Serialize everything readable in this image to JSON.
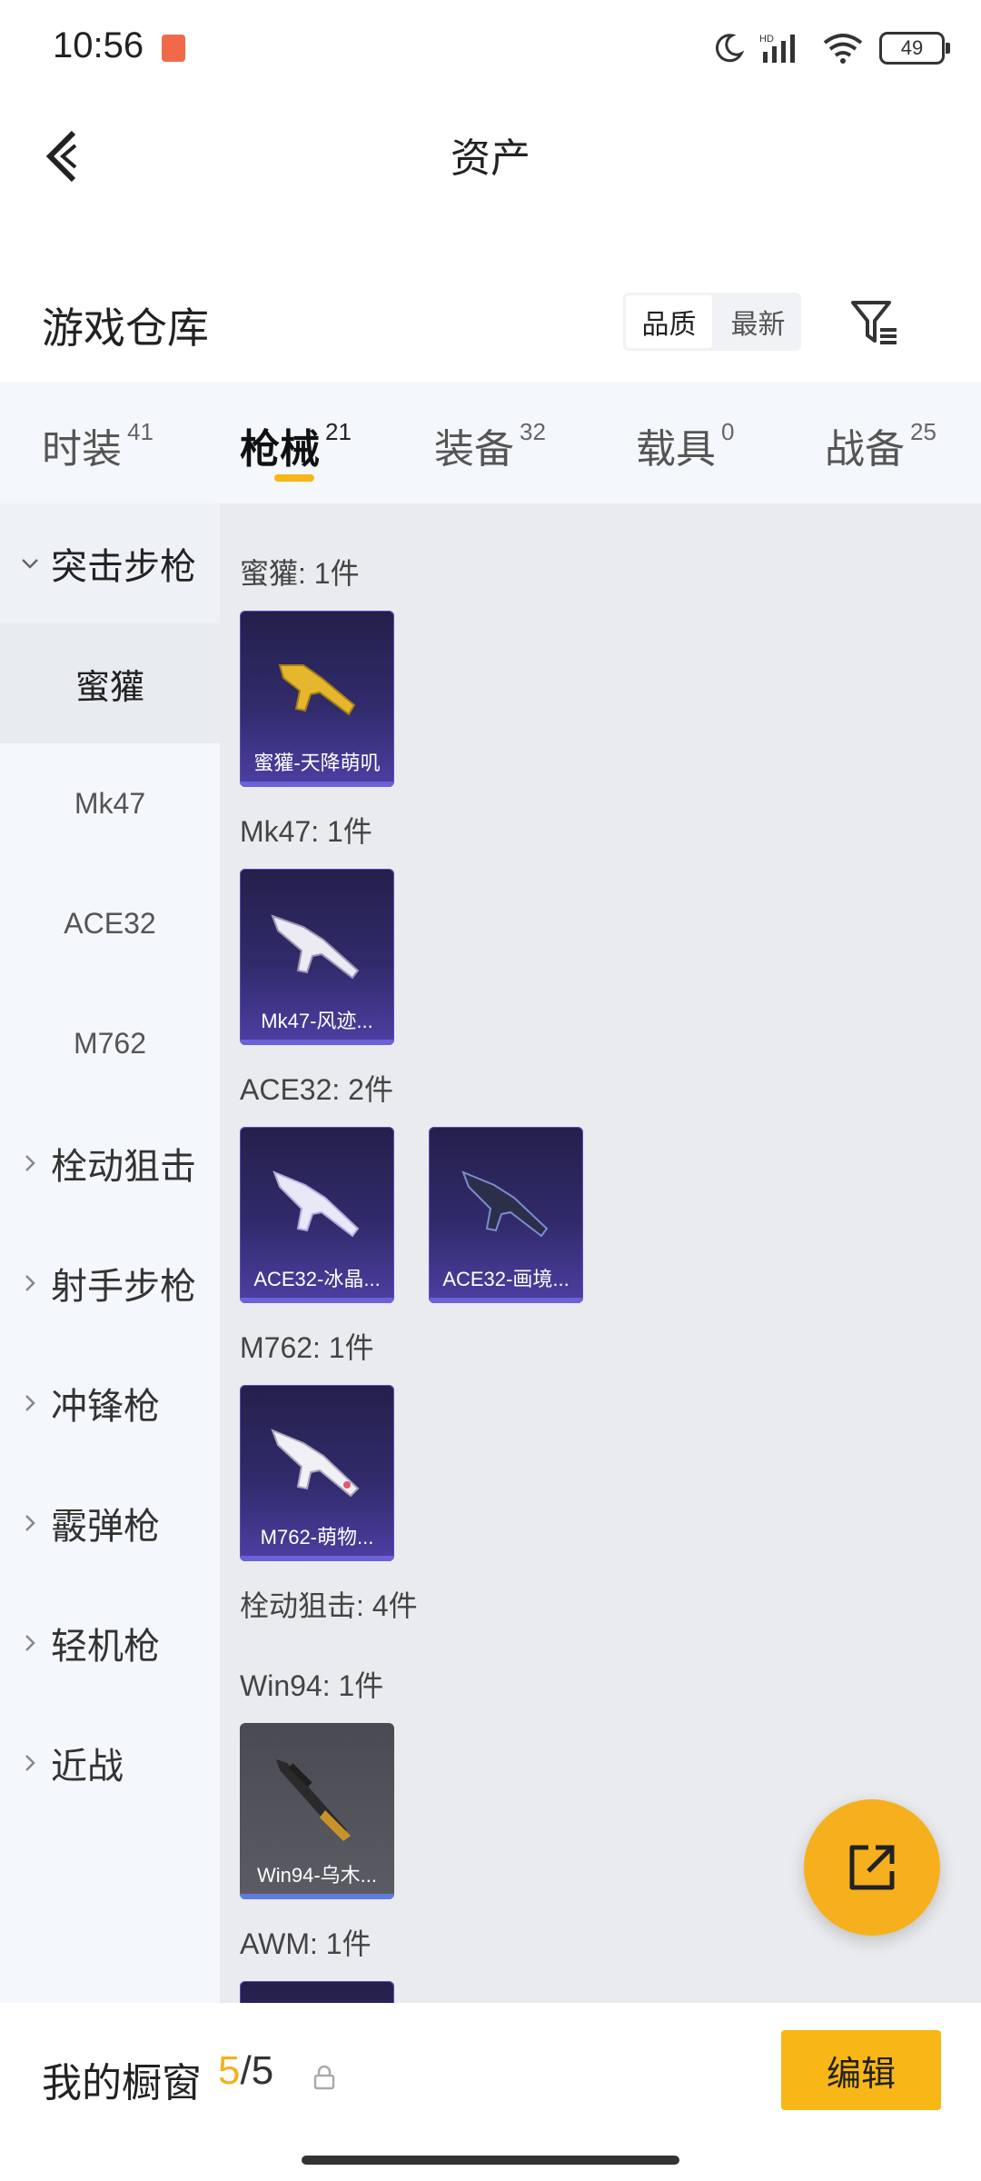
{
  "status_bar": {
    "time": "10:56",
    "battery": "49"
  },
  "header": {
    "title": "资产"
  },
  "warehouse": {
    "title": "游戏仓库",
    "sort_options": [
      "品质",
      "最新"
    ],
    "sort_active": "品质"
  },
  "tabs": [
    {
      "label": "时装",
      "count": "41"
    },
    {
      "label": "枪械",
      "count": "21",
      "active": true
    },
    {
      "label": "装备",
      "count": "32"
    },
    {
      "label": "载具",
      "count": "0"
    },
    {
      "label": "战备",
      "count": "25"
    }
  ],
  "sidebar": [
    {
      "label": "突击步枪",
      "type": "group",
      "open": true
    },
    {
      "label": "蜜獾",
      "type": "sub",
      "active": true
    },
    {
      "label": "Mk47",
      "type": "sub"
    },
    {
      "label": "ACE32",
      "type": "sub"
    },
    {
      "label": "M762",
      "type": "sub"
    },
    {
      "label": "栓动狙击",
      "type": "group"
    },
    {
      "label": "射手步枪",
      "type": "group"
    },
    {
      "label": "冲锋枪",
      "type": "group"
    },
    {
      "label": "霰弹枪",
      "type": "group"
    },
    {
      "label": "轻机枪",
      "type": "group"
    },
    {
      "label": "近战",
      "type": "group"
    }
  ],
  "content": {
    "sections": [
      {
        "label": "蜜獾: 1件",
        "items": [
          "蜜獾-天降萌叽"
        ]
      },
      {
        "label": "Mk47: 1件",
        "items": [
          "Mk47-风迹..."
        ]
      },
      {
        "label": "ACE32: 2件",
        "items": [
          "ACE32-冰晶...",
          "ACE32-画境..."
        ]
      },
      {
        "label": "M762: 1件",
        "items": [
          "M762-萌物..."
        ]
      },
      {
        "label": "栓动狙击: 4件",
        "items": []
      },
      {
        "label": "Win94: 1件",
        "items": [
          "Win94-乌木..."
        ]
      },
      {
        "label": "AWM: 1件",
        "items": []
      }
    ]
  },
  "bottom_bar": {
    "title": "我的橱窗",
    "used": "5",
    "total": "/5",
    "edit_label": "编辑"
  },
  "colors": {
    "accent": "#f8b617",
    "card_purple": "#312b6c",
    "card_grey": "#55565c"
  },
  "icons": [
    "back-arrow-icon",
    "filter-icon",
    "share-icon",
    "lock-icon",
    "chevron-down-icon",
    "chevron-right-icon"
  ]
}
